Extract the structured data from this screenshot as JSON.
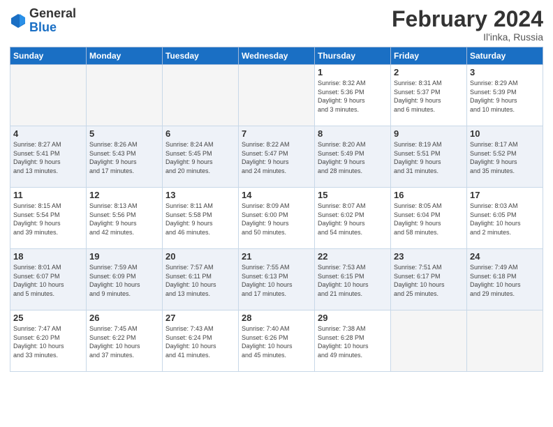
{
  "header": {
    "logo_general": "General",
    "logo_blue": "Blue",
    "title": "February 2024",
    "location": "Il'inka, Russia"
  },
  "days_of_week": [
    "Sunday",
    "Monday",
    "Tuesday",
    "Wednesday",
    "Thursday",
    "Friday",
    "Saturday"
  ],
  "weeks": [
    [
      {
        "day": "",
        "info": ""
      },
      {
        "day": "",
        "info": ""
      },
      {
        "day": "",
        "info": ""
      },
      {
        "day": "",
        "info": ""
      },
      {
        "day": "1",
        "info": "Sunrise: 8:32 AM\nSunset: 5:36 PM\nDaylight: 9 hours\nand 3 minutes."
      },
      {
        "day": "2",
        "info": "Sunrise: 8:31 AM\nSunset: 5:37 PM\nDaylight: 9 hours\nand 6 minutes."
      },
      {
        "day": "3",
        "info": "Sunrise: 8:29 AM\nSunset: 5:39 PM\nDaylight: 9 hours\nand 10 minutes."
      }
    ],
    [
      {
        "day": "4",
        "info": "Sunrise: 8:27 AM\nSunset: 5:41 PM\nDaylight: 9 hours\nand 13 minutes."
      },
      {
        "day": "5",
        "info": "Sunrise: 8:26 AM\nSunset: 5:43 PM\nDaylight: 9 hours\nand 17 minutes."
      },
      {
        "day": "6",
        "info": "Sunrise: 8:24 AM\nSunset: 5:45 PM\nDaylight: 9 hours\nand 20 minutes."
      },
      {
        "day": "7",
        "info": "Sunrise: 8:22 AM\nSunset: 5:47 PM\nDaylight: 9 hours\nand 24 minutes."
      },
      {
        "day": "8",
        "info": "Sunrise: 8:20 AM\nSunset: 5:49 PM\nDaylight: 9 hours\nand 28 minutes."
      },
      {
        "day": "9",
        "info": "Sunrise: 8:19 AM\nSunset: 5:51 PM\nDaylight: 9 hours\nand 31 minutes."
      },
      {
        "day": "10",
        "info": "Sunrise: 8:17 AM\nSunset: 5:52 PM\nDaylight: 9 hours\nand 35 minutes."
      }
    ],
    [
      {
        "day": "11",
        "info": "Sunrise: 8:15 AM\nSunset: 5:54 PM\nDaylight: 9 hours\nand 39 minutes."
      },
      {
        "day": "12",
        "info": "Sunrise: 8:13 AM\nSunset: 5:56 PM\nDaylight: 9 hours\nand 42 minutes."
      },
      {
        "day": "13",
        "info": "Sunrise: 8:11 AM\nSunset: 5:58 PM\nDaylight: 9 hours\nand 46 minutes."
      },
      {
        "day": "14",
        "info": "Sunrise: 8:09 AM\nSunset: 6:00 PM\nDaylight: 9 hours\nand 50 minutes."
      },
      {
        "day": "15",
        "info": "Sunrise: 8:07 AM\nSunset: 6:02 PM\nDaylight: 9 hours\nand 54 minutes."
      },
      {
        "day": "16",
        "info": "Sunrise: 8:05 AM\nSunset: 6:04 PM\nDaylight: 9 hours\nand 58 minutes."
      },
      {
        "day": "17",
        "info": "Sunrise: 8:03 AM\nSunset: 6:05 PM\nDaylight: 10 hours\nand 2 minutes."
      }
    ],
    [
      {
        "day": "18",
        "info": "Sunrise: 8:01 AM\nSunset: 6:07 PM\nDaylight: 10 hours\nand 5 minutes."
      },
      {
        "day": "19",
        "info": "Sunrise: 7:59 AM\nSunset: 6:09 PM\nDaylight: 10 hours\nand 9 minutes."
      },
      {
        "day": "20",
        "info": "Sunrise: 7:57 AM\nSunset: 6:11 PM\nDaylight: 10 hours\nand 13 minutes."
      },
      {
        "day": "21",
        "info": "Sunrise: 7:55 AM\nSunset: 6:13 PM\nDaylight: 10 hours\nand 17 minutes."
      },
      {
        "day": "22",
        "info": "Sunrise: 7:53 AM\nSunset: 6:15 PM\nDaylight: 10 hours\nand 21 minutes."
      },
      {
        "day": "23",
        "info": "Sunrise: 7:51 AM\nSunset: 6:17 PM\nDaylight: 10 hours\nand 25 minutes."
      },
      {
        "day": "24",
        "info": "Sunrise: 7:49 AM\nSunset: 6:18 PM\nDaylight: 10 hours\nand 29 minutes."
      }
    ],
    [
      {
        "day": "25",
        "info": "Sunrise: 7:47 AM\nSunset: 6:20 PM\nDaylight: 10 hours\nand 33 minutes."
      },
      {
        "day": "26",
        "info": "Sunrise: 7:45 AM\nSunset: 6:22 PM\nDaylight: 10 hours\nand 37 minutes."
      },
      {
        "day": "27",
        "info": "Sunrise: 7:43 AM\nSunset: 6:24 PM\nDaylight: 10 hours\nand 41 minutes."
      },
      {
        "day": "28",
        "info": "Sunrise: 7:40 AM\nSunset: 6:26 PM\nDaylight: 10 hours\nand 45 minutes."
      },
      {
        "day": "29",
        "info": "Sunrise: 7:38 AM\nSunset: 6:28 PM\nDaylight: 10 hours\nand 49 minutes."
      },
      {
        "day": "",
        "info": ""
      },
      {
        "day": "",
        "info": ""
      }
    ]
  ]
}
